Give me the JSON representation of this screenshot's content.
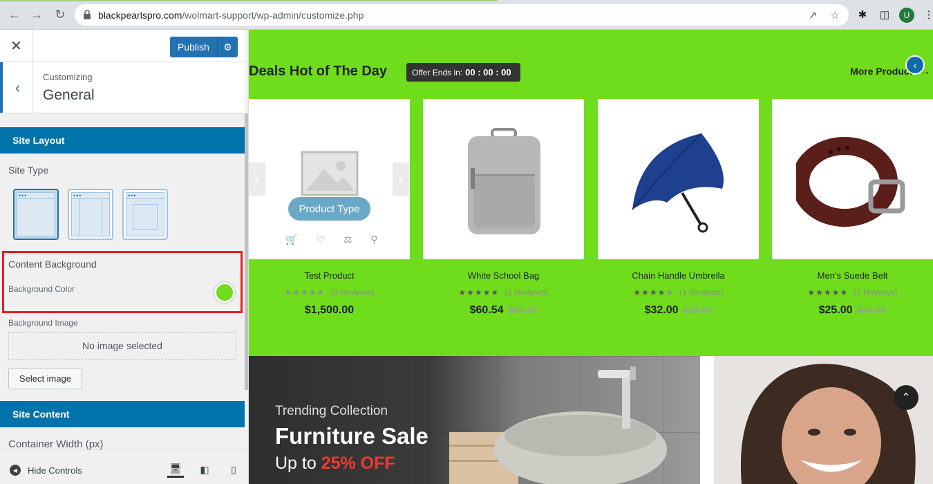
{
  "browser": {
    "url_host": "blackpearlspro.com",
    "url_path": "/wolmart-support/wp-admin/customize.php",
    "avatar_letter": "U"
  },
  "customizer": {
    "publish_label": "Publish",
    "customizing_label": "Customizing",
    "section_title": "General",
    "site_layout_header": "Site Layout",
    "site_type_label": "Site Type",
    "content_background_label": "Content Background",
    "background_color_label": "Background Color",
    "background_color_value": "#6fdd1b",
    "background_image_label": "Background Image",
    "no_image_text": "No image selected",
    "select_image_label": "Select image",
    "site_content_header": "Site Content",
    "container_width_label": "Container Width (px)",
    "hide_controls_label": "Hide Controls"
  },
  "preview": {
    "deals_title": "Deals Hot of The Day",
    "offer_label": "Offer Ends in:",
    "offer_timer": "00 : 00 : 00",
    "more_products": "More Products",
    "product_type_label": "Product Type",
    "products": [
      {
        "name": "Test Product",
        "reviews": "(0 Reviews)",
        "price": "$1,500.00",
        "old_price": "",
        "rating": 0
      },
      {
        "name": "White School Bag",
        "reviews": "(1 Reviews)",
        "price": "$60.54",
        "old_price": "$65.25",
        "rating": 5
      },
      {
        "name": "Chain Handle Umbrella",
        "reviews": "(1 Reviews)",
        "price": "$32.00",
        "old_price": "$35.00",
        "rating": 4
      },
      {
        "name": "Men’s Suede Belt",
        "reviews": "(1 Reviews)",
        "price": "$25.00",
        "old_price": "$26.55",
        "rating": 5
      }
    ],
    "banner": {
      "trending": "Trending Collection",
      "title": "Furniture Sale",
      "sub_prefix": "Up to ",
      "sub_highlight": "25% OFF"
    }
  }
}
